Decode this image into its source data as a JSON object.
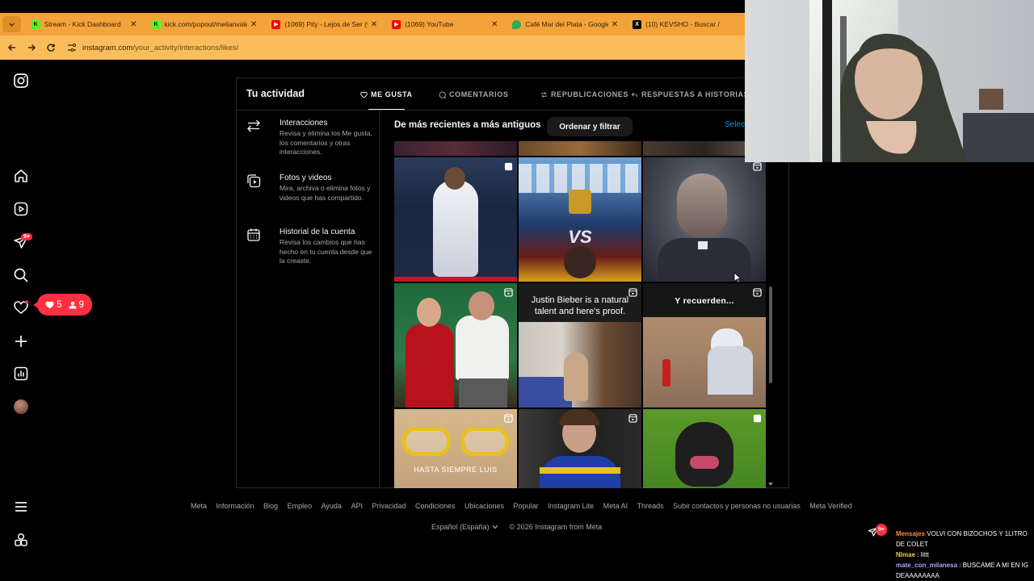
{
  "browser": {
    "tabs": [
      {
        "title": "Stream - Kick Dashboard",
        "favicon": "kick-icon",
        "color": "#53fc18"
      },
      {
        "title": "kick.com/popout/melianvalen/c",
        "favicon": "kick-icon",
        "color": "#53fc18"
      },
      {
        "title": "(1069) Pity - Lejos de Ser (vide",
        "favicon": "youtube-icon",
        "color": "#ff0000"
      },
      {
        "title": "(1069) YouTube",
        "favicon": "youtube-icon",
        "color": "#ff0000"
      },
      {
        "title": "Café Mar del Plata - Google Ma",
        "favicon": "maps-icon",
        "color": "#34a853"
      },
      {
        "title": "(10) KEVSHO - Buscar /",
        "favicon": "x-icon",
        "color": "#000000"
      }
    ],
    "close_glyph": "✕",
    "url_domain": "instagram.com",
    "url_path": "/your_activity/interactions/likes/"
  },
  "sidebar": {
    "messages_badge": "9+",
    "notif_pill": {
      "likes": "5",
      "follows": "9"
    }
  },
  "activity": {
    "title": "Tu actividad",
    "tabs": [
      {
        "label": "ME GUSTA",
        "icon": "heart-icon",
        "active": true
      },
      {
        "label": "COMENTARIOS",
        "icon": "comment-icon",
        "active": false
      },
      {
        "label": "REPUBLICACIONES",
        "icon": "repost-icon",
        "active": false
      },
      {
        "label": "RESPUESTAS A HISTORIAS",
        "icon": "reply-icon",
        "active": false
      }
    ],
    "menu": [
      {
        "title": "Interacciones",
        "desc": "Revisa y elimina los Me gusta, los comentarios y otras interacciones.",
        "icon": "interactions-icon"
      },
      {
        "title": "Fotos y videos",
        "desc": "Mira, archiva o elimina fotos y videos que has compartido.",
        "icon": "media-icon"
      },
      {
        "title": "Historial de la cuenta",
        "desc": "Revisa los cambios que has hecho en tu cuenta desde que la creaste.",
        "icon": "calendar-icon"
      }
    ],
    "sort_label": "De más recientes a más antiguos",
    "sort_button": "Ordenar y filtrar",
    "select_link": "Selecc",
    "grid": [
      {
        "kind": "post",
        "caption": ""
      },
      {
        "kind": "post",
        "caption": ""
      },
      {
        "kind": "reel",
        "caption": ""
      },
      {
        "kind": "reel",
        "caption": ""
      },
      {
        "kind": "reel",
        "caption": "Justin Bieber is a natural talent and here's proof."
      },
      {
        "kind": "reel",
        "caption": "Y recuerden..."
      },
      {
        "kind": "reel",
        "caption": "HASTA SIEMPRE LUIS"
      },
      {
        "kind": "reel",
        "caption": ""
      },
      {
        "kind": "post",
        "caption": ""
      }
    ]
  },
  "footer": {
    "links": [
      "Meta",
      "Información",
      "Blog",
      "Empleo",
      "Ayuda",
      "API",
      "Privacidad",
      "Condiciones",
      "Ubicaciones",
      "Popular",
      "Instagram Lite",
      "Meta AI",
      "Threads",
      "Subir contactos y personas no usuarias",
      "Meta Verified"
    ],
    "language": "Español (España)",
    "copyright": "© 2026 Instagram from Meta"
  },
  "chat": {
    "badge": "9+",
    "messages": [
      {
        "user": "Mensajes",
        "text": "VOLVI CON BIZOCHOS Y 1LITRO DE COLET"
      },
      {
        "user": "Nlmae",
        "text": "littt"
      },
      {
        "user": "mate_con_milanesa",
        "text": "BUSCAME A MI EN IG DEAAAAAAAA"
      }
    ]
  }
}
